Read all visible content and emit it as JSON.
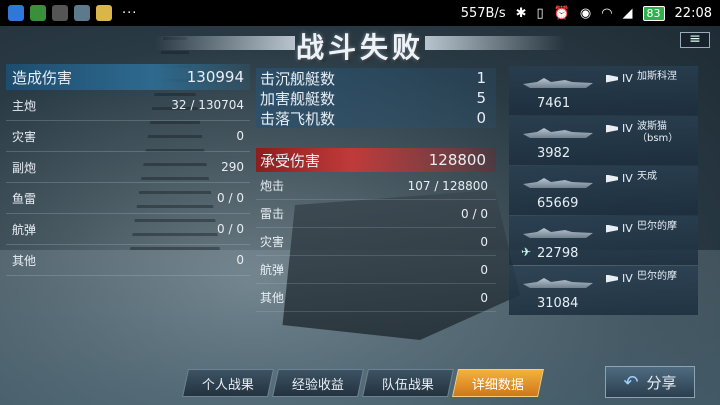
{
  "statusbar": {
    "speed": "557B/s",
    "battery": "83",
    "time": "22:08",
    "dots": "···"
  },
  "title": "战斗失败",
  "close_label": "≡",
  "left": {
    "header": {
      "label": "造成伤害",
      "value": "130994"
    },
    "rows": [
      {
        "label": "主炮",
        "value": "32 / 130704"
      },
      {
        "label": "灾害",
        "value": "0"
      },
      {
        "label": "副炮",
        "value": "290"
      },
      {
        "label": "鱼雷",
        "value": "0 / 0"
      },
      {
        "label": "航弹",
        "value": "0 / 0"
      },
      {
        "label": "其他",
        "value": "0"
      }
    ]
  },
  "mid": {
    "counts": [
      {
        "label": "击沉舰艇数",
        "value": "1"
      },
      {
        "label": "加害舰艇数",
        "value": "5"
      },
      {
        "label": "击落飞机数",
        "value": "0"
      }
    ],
    "damage_header": {
      "label": "承受伤害",
      "value": "128800"
    },
    "rows": [
      {
        "label": "炮击",
        "value": "107 / 128800"
      },
      {
        "label": "雷击",
        "value": "0 / 0"
      },
      {
        "label": "灾害",
        "value": "0"
      },
      {
        "label": "航弹",
        "value": "0"
      },
      {
        "label": "其他",
        "value": "0"
      }
    ]
  },
  "ships": [
    {
      "tier": "IV",
      "name": "加斯科涅",
      "damage": "7461"
    },
    {
      "tier": "IV",
      "name": "波斯猫（bsm）",
      "damage": "3982"
    },
    {
      "tier": "IV",
      "name": "天成",
      "damage": "65669"
    },
    {
      "tier": "IV",
      "name": "巴尔的摩",
      "damage": "22798"
    },
    {
      "tier": "IV",
      "name": "巴尔的摩",
      "damage": "31084"
    }
  ],
  "tabs": [
    "个人战果",
    "经验收益",
    "队伍战果",
    "详细数据"
  ],
  "share_label": "分享"
}
